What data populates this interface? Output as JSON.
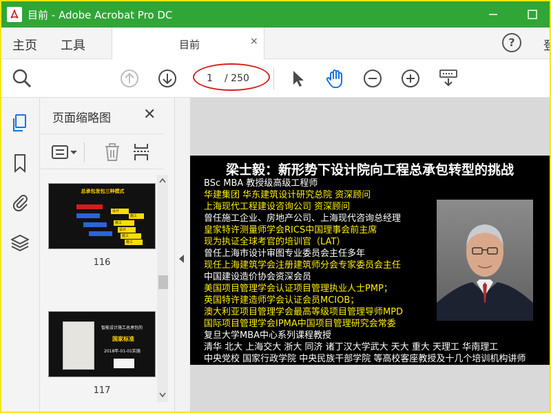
{
  "window": {
    "title": "目前 - Adobe Acrobat Pro DC",
    "minimize_icon": "minimize-icon",
    "maximize_icon": "maximize-icon"
  },
  "nav": {
    "home": "主页",
    "tools": "工具",
    "cut_off_label": "登"
  },
  "doc_tab": {
    "label": "目前",
    "close": "×"
  },
  "help": {
    "label": "?"
  },
  "toolbar": {
    "current_page": "1",
    "total_pages": "/ 250",
    "icons": [
      "zoom-search-icon",
      "page-up-icon",
      "page-down-icon",
      "select-pointer-icon",
      "hand-tool-icon",
      "zoom-out-icon",
      "zoom-in-icon",
      "keyboard-fit-icon"
    ]
  },
  "panel": {
    "title": "页面缩略图",
    "close": "✕",
    "thumbnails": [
      {
        "number": "116",
        "title": "总承包发包三种模式",
        "labels": [
          "设计",
          "施工",
          "施工",
          "设计",
          "施工",
          "施工"
        ]
      },
      {
        "number": "117",
        "lines": [
          "智能设计施工总承包的",
          "国家标准",
          "2018年-01-01实施"
        ]
      }
    ]
  },
  "slide": {
    "title": "梁士毅：新形势下设计院向工程总承包转型的挑战",
    "lines": [
      {
        "text": "BSc MBA 教授级高级工程师",
        "color": "w"
      },
      {
        "text": "华建集团 华东建筑设计研究总院 资深顾问",
        "color": "y"
      },
      {
        "text": "上海现代工程建设咨询公司        资深顾问",
        "color": "y"
      },
      {
        "text": "曾任施工企业、房地产公司、上海现代咨询总经理",
        "color": "w"
      },
      {
        "text": "皇家特许测量师学会RICS中国理事会前主席",
        "color": "y"
      },
      {
        "text": "现为执证全球考官的培训官（LAT）",
        "color": "y"
      },
      {
        "text": "曾任上海市设计审图专业委员会主任多年",
        "color": "w"
      },
      {
        "text": "现任上海建筑学会注册建筑师分会专家委员会主任",
        "color": "y"
      },
      {
        "text": "中国建设造价协会资深会员",
        "color": "w"
      },
      {
        "text": "美国项目管理学会认证项目管理执业人士PMP；",
        "color": "y"
      },
      {
        "text": "英国特许建造师学会认证会员MCIOB；",
        "color": "y"
      },
      {
        "text": "澳大利亚项目管理学会最高等级项目管理导师MPD",
        "color": "y"
      },
      {
        "text": "国际项目管理学会IPMA中国项目管理研究会常委",
        "color": "y"
      },
      {
        "text": "复旦大学MBA中心系列课程教授",
        "color": "w"
      },
      {
        "text": "清华 北大 上海交大 浙大 同济 诸丁汉大学武大 天大 重大 天理工 华南理工",
        "color": "w"
      },
      {
        "text": "中央党校 国家行政学院 中央民族干部学院 等高校客座教授及十几个培训机构讲师",
        "color": "w"
      }
    ]
  },
  "colors": {
    "titlebar": "#30a636",
    "annotation": "#d91e1e",
    "highlight_text": "#ffee00",
    "active_tool": "#1473e6"
  }
}
